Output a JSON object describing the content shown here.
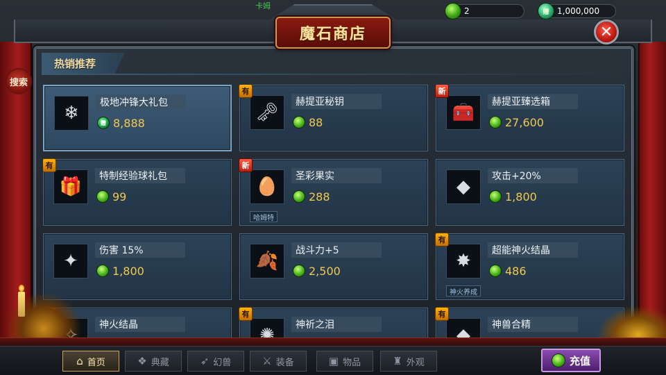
{
  "title": "魔石商店",
  "top_label": "卡姆",
  "currency": {
    "gem_count": "2",
    "bound_gem_count": "1,000,000",
    "bound_gem_mark": "赠"
  },
  "search_label": "搜索",
  "close_label": "✕",
  "section_title": "热销推荐",
  "badges": {
    "hot": "有",
    "new": "新"
  },
  "items": [
    {
      "name": "极地冲锋大礼包",
      "price": "8,888",
      "currency": "bound",
      "icon": "gift-box-icon",
      "glyph": "❄",
      "badge": "",
      "tag": "",
      "selected": true
    },
    {
      "name": "赫提亚秘钥",
      "price": "88",
      "currency": "gem",
      "icon": "key-icon",
      "glyph": "🗝",
      "badge": "hot",
      "tag": ""
    },
    {
      "name": "赫提亚臻选箱",
      "price": "27,600",
      "currency": "gem",
      "icon": "chest-icon",
      "glyph": "🧰",
      "badge": "new",
      "tag": ""
    },
    {
      "name": "特制经验球礼包",
      "price": "99",
      "currency": "gem",
      "icon": "red-gift-icon",
      "glyph": "🎁",
      "badge": "hot",
      "tag": ""
    },
    {
      "name": "圣彩果实",
      "price": "288",
      "currency": "gem",
      "icon": "fruit-icon",
      "glyph": "🥚",
      "badge": "new",
      "tag": "哈姆特"
    },
    {
      "name": "攻击+20%",
      "price": "1,800",
      "currency": "gem",
      "icon": "gold-crystal-icon",
      "glyph": "◆",
      "badge": "",
      "tag": ""
    },
    {
      "name": "伤害 15%",
      "price": "1,800",
      "currency": "gem",
      "icon": "green-crystal-icon",
      "glyph": "✦",
      "badge": "",
      "tag": ""
    },
    {
      "name": "战斗力+5",
      "price": "2,500",
      "currency": "gem",
      "icon": "feather-icon",
      "glyph": "🍂",
      "badge": "",
      "tag": ""
    },
    {
      "name": "超能神火结晶",
      "price": "486",
      "currency": "gem",
      "icon": "red-crystal-icon",
      "glyph": "✸",
      "badge": "hot",
      "tag": "神火养成"
    },
    {
      "name": "神火结晶",
      "price": "",
      "currency": "gem",
      "icon": "crystal-icon",
      "glyph": "✧",
      "badge": "hot",
      "tag": ""
    },
    {
      "name": "神祈之泪",
      "price": "",
      "currency": "gem",
      "icon": "tear-icon",
      "glyph": "✺",
      "badge": "hot",
      "tag": ""
    },
    {
      "name": "神兽合精",
      "price": "",
      "currency": "gem",
      "icon": "purple-crystal-icon",
      "glyph": "◆",
      "badge": "hot",
      "tag": ""
    }
  ],
  "nav": [
    {
      "label": "首页",
      "icon": "home-icon",
      "glyph": "⌂",
      "active": true
    },
    {
      "label": "典藏",
      "icon": "collection-icon",
      "glyph": "❖"
    },
    {
      "label": "幻兽",
      "icon": "beast-icon",
      "glyph": "➶"
    },
    {
      "label": "装备",
      "icon": "equipment-icon",
      "glyph": "⚔"
    },
    {
      "label": "物品",
      "icon": "items-icon",
      "glyph": "▣"
    },
    {
      "label": "外观",
      "icon": "appearance-icon",
      "glyph": "♜"
    }
  ],
  "recharge_label": "充值",
  "colors": {
    "price": "#f2c94c",
    "accent_gold": "#ffe3a0",
    "recharge": "#8a4bb0"
  }
}
